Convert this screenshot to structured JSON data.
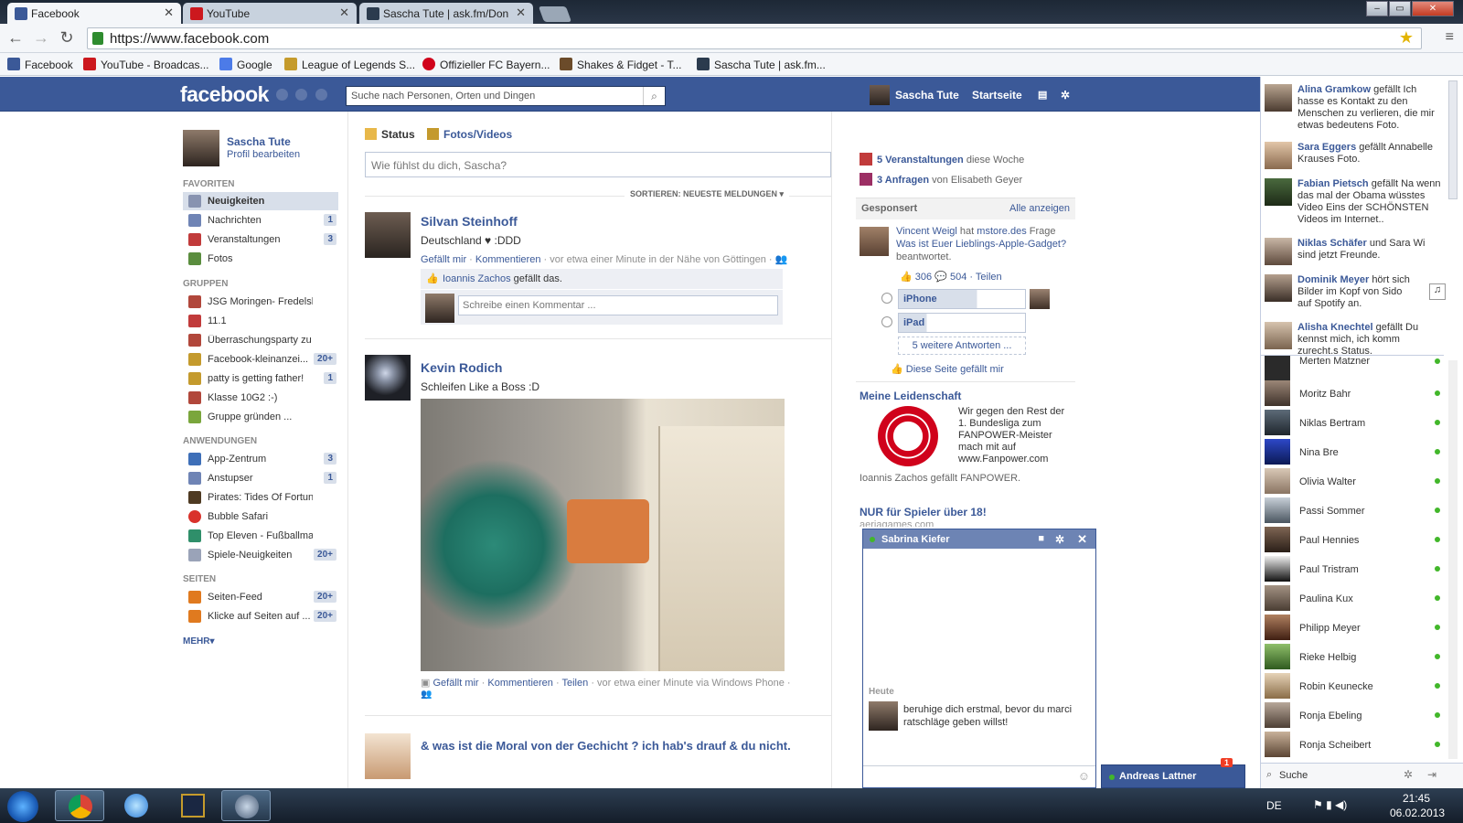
{
  "browser": {
    "tabs": [
      {
        "label": "Facebook",
        "icon": "facebook-icon",
        "active": true
      },
      {
        "label": "YouTube",
        "icon": "youtube-icon",
        "active": false
      },
      {
        "label": "Sascha Tute | ask.fm/Don",
        "icon": "askfm-icon",
        "active": false
      }
    ],
    "url": "https://www.facebook.com",
    "bookmarks": [
      "Facebook",
      "YouTube - Broadcas...",
      "Google",
      "League of Legends S...",
      "Offizieller FC Bayern...",
      "Shakes & Fidget - T...",
      "Sascha Tute | ask.fm..."
    ]
  },
  "header": {
    "logo": "facebook",
    "search_placeholder": "Suche nach Personen, Orten und Dingen",
    "user_name": "Sascha Tute",
    "home": "Startseite"
  },
  "left": {
    "profile_name": "Sascha Tute",
    "profile_edit": "Profil bearbeiten",
    "favorites_label": "FAVORITEN",
    "favorites": [
      {
        "label": "Neuigkeiten",
        "count": ""
      },
      {
        "label": "Nachrichten",
        "count": "1"
      },
      {
        "label": "Veranstaltungen",
        "count": "3"
      },
      {
        "label": "Fotos",
        "count": ""
      }
    ],
    "groups_label": "GRUPPEN",
    "groups": [
      {
        "label": "JSG Moringen- Fredelsloh A...",
        "count": ""
      },
      {
        "label": "11.1",
        "count": ""
      },
      {
        "label": "Überraschungsparty zu Jan...",
        "count": ""
      },
      {
        "label": "Facebook-kleinanzei...",
        "count": "20+"
      },
      {
        "label": "patty is getting father!",
        "count": "1"
      },
      {
        "label": "Klasse 10G2 :-)",
        "count": ""
      },
      {
        "label": "Gruppe gründen ...",
        "count": ""
      }
    ],
    "apps_label": "ANWENDUNGEN",
    "apps": [
      {
        "label": "App-Zentrum",
        "count": "3"
      },
      {
        "label": "Anstupser",
        "count": "1"
      },
      {
        "label": "Pirates: Tides Of Fortune",
        "count": ""
      },
      {
        "label": "Bubble Safari",
        "count": ""
      },
      {
        "label": "Top Eleven - Fußballmanager",
        "count": ""
      },
      {
        "label": "Spiele-Neuigkeiten",
        "count": "20+"
      }
    ],
    "pages_label": "SEITEN",
    "pages": [
      {
        "label": "Seiten-Feed",
        "count": "20+"
      },
      {
        "label": "Klicke auf Seiten auf ...",
        "count": "20+"
      }
    ],
    "more": "MEHR▾"
  },
  "composer": {
    "status_tab": "Status",
    "photos_tab": "Fotos/Videos",
    "placeholder": "Wie fühlst du dich, Sascha?",
    "sort": "SORTIEREN: NEUESTE MELDUNGEN ▾"
  },
  "posts": [
    {
      "author": "Silvan Steinhoff",
      "text": "Deutschland ♥ :DDD",
      "like": "Gefällt mir",
      "comment": "Kommentieren",
      "meta": "· vor etwa einer Minute in der Nähe von Göttingen ·",
      "likers": "Ioannis Zachos",
      "likes_suffix": "gefällt das.",
      "comment_placeholder": "Schreibe einen Kommentar ..."
    },
    {
      "author": "Kevin Rodich",
      "text": "Schleifen Like a Boss :D",
      "like": "Gefällt mir",
      "comment": "Kommentieren",
      "share": "Teilen",
      "meta": "· vor etwa einer Minute via Windows Phone ·"
    },
    {
      "author": "& was ist die Moral von der Gechicht ? ich hab's drauf & du nicht."
    }
  ],
  "rightcol": {
    "events_count": "5 Veranstaltungen",
    "events_suffix": "diese Woche",
    "requests_count": "3 Anfragen",
    "requests_suffix": "von Elisabeth Geyer",
    "sponsored": "Gesponsert",
    "show_all": "Alle anzeigen",
    "question_author": "Vincent Weigl",
    "question_mid": "hat",
    "question_source": "mstore.des",
    "question_label": "Frage",
    "question_text": "Was ist Euer Lieblings-Apple-Gadget?",
    "question_suffix": "beantwortet.",
    "likes": "306",
    "comments": "504",
    "share": "· Teilen",
    "option1": "iPhone",
    "option2": "iPad",
    "more_answers": "5 weitere Antworten ...",
    "page_like": "Diese Seite gefällt mir",
    "ad_title": "Meine Leidenschaft",
    "ad_text": "Wir gegen den Rest der 1. Bundesliga zum FANPOWER-Meister mach mit auf www.Fanpower.com",
    "ad_footer": "Ioannis Zachos gefällt FANPOWER.",
    "ad2_title": "NUR für Spieler über 18!",
    "ad2_sub": "aeriagames.com"
  },
  "chat_window": {
    "name": "Sabrina Kiefer",
    "day": "Heute",
    "message": "beruhige dich erstmal, bevor du marci ratschläge geben willst!"
  },
  "chat_tab": {
    "name": "Andreas Lattner",
    "badge": "1"
  },
  "ticker": [
    {
      "name": "Alina Gramkow",
      "text": "gefällt Ich hasse es Kontakt zu den Menschen zu verlieren, die mir etwas bedeutens Foto."
    },
    {
      "name": "Sara Eggers",
      "text": "gefällt Annabelle Krauses Foto."
    },
    {
      "name": "Fabian Pietsch",
      "text": "gefällt Na wenn das mal der Obama wüsstes Video Eins der SCHÖNSTEN Videos im Internet.."
    },
    {
      "name": "Niklas Schäfer",
      "text": "und Sara Wi sind jetzt Freunde."
    },
    {
      "name": "Dominik Meyer",
      "text": "hört sich Bilder im Kopf von Sido auf Spotify an."
    },
    {
      "name": "Alisha Knechtel",
      "text": "gefällt Du kennst mich, ich komm zurecht.s Status."
    }
  ],
  "chat_list": [
    "Merten Matzner",
    "Moritz Bahr",
    "Niklas Bertram",
    "Nina Bre",
    "Olivia Walter",
    "Passi Sommer",
    "Paul Hennies",
    "Paul Tristram",
    "Paulina Kux",
    "Philipp Meyer",
    "Rieke Helbig",
    "Robin Keunecke",
    "Ronja Ebeling",
    "Ronja Scheibert"
  ],
  "chat_search": "Suche",
  "taskbar": {
    "lang": "DE",
    "time": "21:45",
    "date": "06.02.2013"
  }
}
